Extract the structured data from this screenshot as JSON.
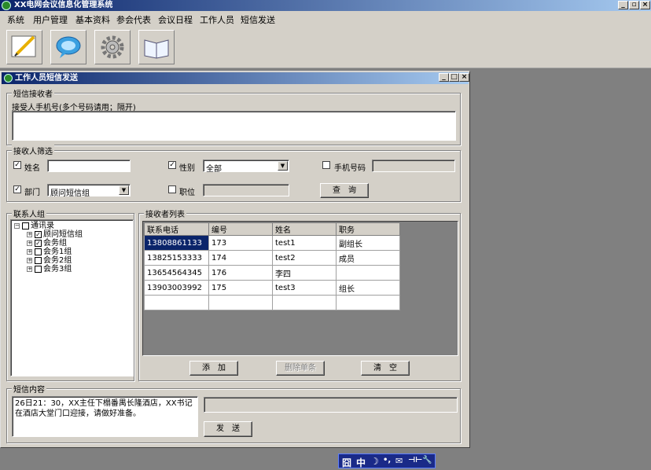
{
  "app": {
    "title": "XX电网会议信息化管理系统"
  },
  "menu": [
    "系统",
    "用户管理",
    "基本资料",
    "参会代表",
    "会议日程",
    "工作人员",
    "短信发送"
  ],
  "window": {
    "title": "工作人员短信发送"
  },
  "receiver_group": {
    "title": "短信接收者",
    "hint": "接受人手机号(多个号码请用；隔开)"
  },
  "filter": {
    "title": "接收人筛选",
    "name_label": "姓名",
    "gender_label": "性别",
    "gender_value": "全部",
    "phone_label": "手机号码",
    "dept_label": "部门",
    "dept_value": "顾问短信组",
    "position_label": "职位",
    "query_button": "查　询",
    "checks": {
      "name": "✓",
      "gender": "✓",
      "phone": "",
      "dept": "✓",
      "position": ""
    }
  },
  "contacts": {
    "title": "联系人组",
    "root": "通讯录",
    "children": [
      {
        "label": "顾问短信组",
        "checked": "✓"
      },
      {
        "label": "会务组",
        "checked": "✓"
      },
      {
        "label": "会务1组",
        "checked": ""
      },
      {
        "label": "会务2组",
        "checked": ""
      },
      {
        "label": "会务3组",
        "checked": ""
      }
    ]
  },
  "list": {
    "title": "接收者列表",
    "columns": [
      "联系电话",
      "编号",
      "姓名",
      "职务"
    ],
    "rows": [
      [
        "13808861133",
        "173",
        "test1",
        "副组长"
      ],
      [
        "13825153333",
        "174",
        "test2",
        "成员"
      ],
      [
        "13654564345",
        "176",
        "李四",
        ""
      ],
      [
        "13903003992",
        "175",
        "test3",
        "组长"
      ],
      [
        "",
        "",
        "",
        ""
      ]
    ],
    "add_button": "添　加",
    "delete_button": "删除单条",
    "clear_button": "清　空"
  },
  "sms": {
    "title": "短信内容",
    "content": "26日21：30，XX主任下榻番禺长隆酒店，XX书记在酒店大堂门口迎接，请做好准备。",
    "send_button": "发　送"
  },
  "tray": {
    "items": [
      "囧",
      "中",
      "☽",
      "•,",
      "✉",
      "⊣⊢",
      "🔧"
    ]
  }
}
